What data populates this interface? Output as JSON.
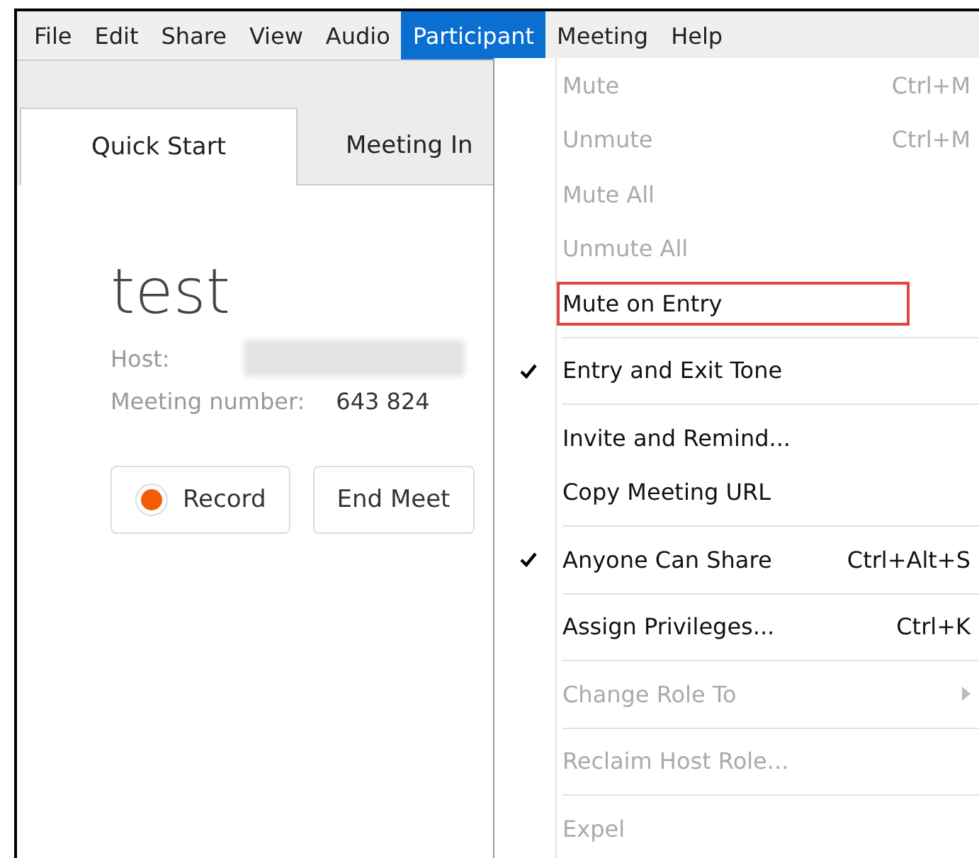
{
  "menubar": [
    {
      "label": "File",
      "selected": false
    },
    {
      "label": "Edit",
      "selected": false
    },
    {
      "label": "Share",
      "selected": false
    },
    {
      "label": "View",
      "selected": false
    },
    {
      "label": "Audio",
      "selected": false
    },
    {
      "label": "Participant",
      "selected": true
    },
    {
      "label": "Meeting",
      "selected": false
    },
    {
      "label": "Help",
      "selected": false
    }
  ],
  "tabs": [
    {
      "label": "Quick Start",
      "selected": true
    },
    {
      "label": "Meeting In",
      "selected": false
    }
  ],
  "meeting": {
    "title": "test",
    "host_label": "Host:",
    "number_label": "Meeting number:",
    "number": "643 824"
  },
  "buttons": [
    {
      "kind": "record",
      "label": "Record"
    },
    {
      "kind": "plain",
      "label": "End Meet"
    }
  ],
  "menu": [
    {
      "kind": "item",
      "label": "Mute",
      "shortcut": "Ctrl+M",
      "disabled": true,
      "checked": false,
      "highlighted": false
    },
    {
      "kind": "item",
      "label": "Unmute",
      "shortcut": "Ctrl+M",
      "disabled": true,
      "checked": false,
      "highlighted": false
    },
    {
      "kind": "item",
      "label": "Mute All",
      "disabled": true,
      "checked": false,
      "highlighted": false
    },
    {
      "kind": "item",
      "label": "Unmute All",
      "disabled": true,
      "checked": false,
      "highlighted": false
    },
    {
      "kind": "item",
      "label": "Mute on Entry",
      "disabled": false,
      "checked": false,
      "highlighted": true
    },
    {
      "kind": "separator"
    },
    {
      "kind": "item",
      "label": "Entry and Exit Tone",
      "disabled": false,
      "checked": true,
      "highlighted": false
    },
    {
      "kind": "separator"
    },
    {
      "kind": "item",
      "label": "Invite and Remind...",
      "disabled": false,
      "checked": false,
      "highlighted": false
    },
    {
      "kind": "item",
      "label": "Copy Meeting URL",
      "disabled": false,
      "checked": false,
      "highlighted": false
    },
    {
      "kind": "separator"
    },
    {
      "kind": "item",
      "label": "Anyone Can Share",
      "shortcut": "Ctrl+Alt+S",
      "disabled": false,
      "checked": true,
      "highlighted": false
    },
    {
      "kind": "separator"
    },
    {
      "kind": "item",
      "label": "Assign Privileges...",
      "shortcut": "Ctrl+K",
      "disabled": false,
      "checked": false,
      "highlighted": false
    },
    {
      "kind": "separator"
    },
    {
      "kind": "submenu",
      "label": "Change Role To",
      "disabled": true,
      "checked": false,
      "highlighted": false
    },
    {
      "kind": "separator"
    },
    {
      "kind": "item",
      "label": "Reclaim Host Role...",
      "disabled": true,
      "checked": false,
      "highlighted": false
    },
    {
      "kind": "separator"
    },
    {
      "kind": "item",
      "label": "Expel",
      "disabled": true,
      "checked": false,
      "highlighted": false
    }
  ]
}
